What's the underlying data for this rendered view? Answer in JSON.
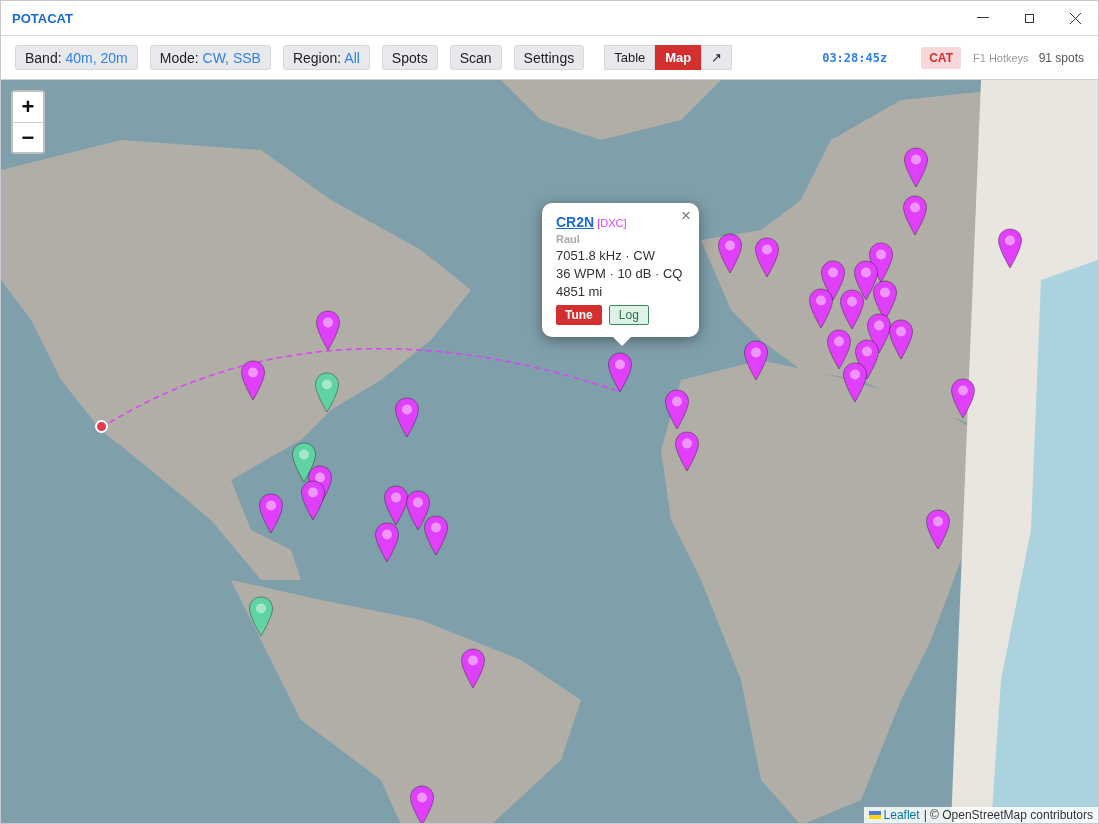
{
  "window": {
    "title": "POTACAT"
  },
  "toolbar": {
    "filters": [
      {
        "label": "Band:",
        "value": "40m, 20m"
      },
      {
        "label": "Mode:",
        "value": "CW, SSB"
      },
      {
        "label": "Region:",
        "value": "All"
      }
    ],
    "buttons": [
      "Spots",
      "Scan",
      "Settings"
    ],
    "views": [
      {
        "label": "Table",
        "selected": false
      },
      {
        "label": "Map",
        "selected": true
      }
    ],
    "popout": "↗",
    "clock": "03:28:45z",
    "cat": "CAT",
    "hotkeys": "F1 Hotkeys",
    "spot_count": "91 spots"
  },
  "map": {
    "zoom": [
      "+",
      "−"
    ],
    "spots": [
      {
        "color": "#e040fb"
      },
      {
        "color": "#e040fb"
      },
      {
        "color": "#e040fb"
      },
      {
        "color": "#e040fb"
      },
      {
        "color": "#e040fb"
      },
      {
        "color": "#e040fb"
      },
      {
        "color": "#e040fb"
      },
      {
        "color": "#e040fb"
      },
      {
        "color": "#e040fb"
      },
      {
        "color": "#e040fb"
      },
      {
        "color": "#5fd3a4"
      },
      {
        "color": "#e040fb"
      },
      {
        "color": "#e040fb"
      },
      {
        "color": "#e040fb"
      },
      {
        "color": "#e040fb"
      },
      {
        "color": "#e040fb"
      },
      {
        "color": "#e040fb"
      },
      {
        "color": "#e040fb"
      },
      {
        "color": "#e040fb"
      },
      {
        "color": "#e040fb"
      },
      {
        "color": "#e040fb"
      },
      {
        "color": "#e040fb"
      },
      {
        "color": "#e040fb"
      },
      {
        "color": "#e040fb"
      },
      {
        "color": "#e040fb"
      },
      {
        "color": "#e040fb"
      },
      {
        "color": "#e040fb"
      },
      {
        "color": "#e040fb"
      },
      {
        "color": "#e040fb"
      },
      {
        "color": "#e040fb"
      },
      {
        "color": "#e040fb"
      },
      {
        "color": "#e040fb"
      },
      {
        "color": "#e040fb"
      },
      {
        "color": "#e040fb"
      },
      {
        "color": "#e040fb"
      },
      {
        "color": "#5fd3a4"
      },
      {
        "color": "#5fd3a4"
      }
    ],
    "popup": {
      "callsign": "CR2N",
      "source": "[DXC]",
      "name": "Raul",
      "lines": [
        "7051.8 kHz · CW",
        "36 WPM · 10 dB · CQ",
        "4851 mi"
      ],
      "tune": "Tune",
      "log": "Log",
      "close": "×"
    },
    "attribution": {
      "link": "Leaflet",
      "text": "| © OpenStreetMap contributors"
    }
  }
}
